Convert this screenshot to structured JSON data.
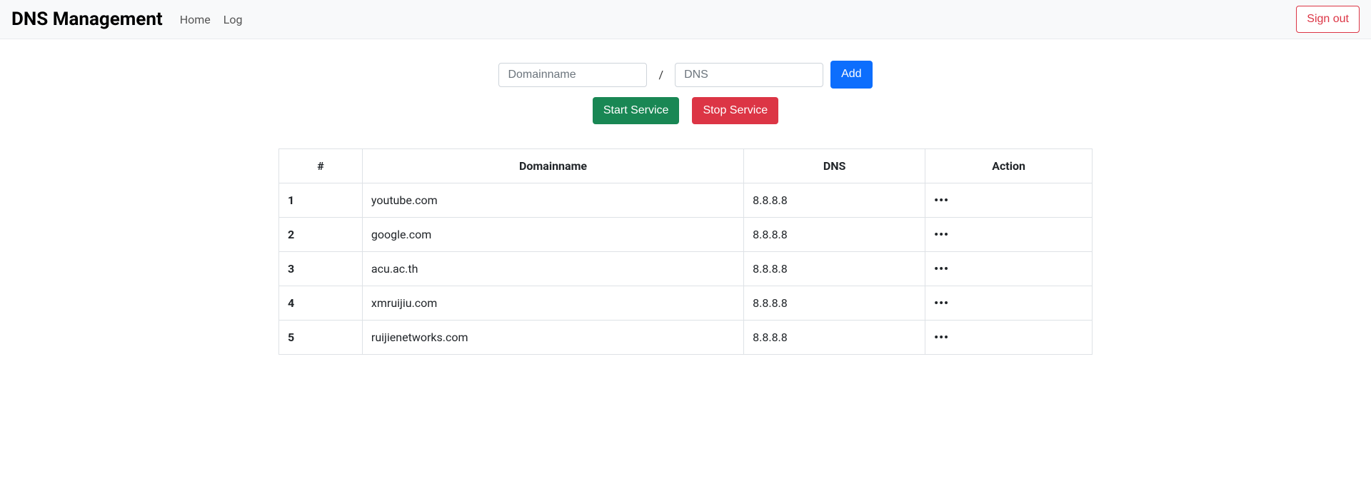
{
  "navbar": {
    "brand": "DNS Management",
    "home": "Home",
    "log": "Log",
    "signout": "Sign out"
  },
  "form": {
    "domain_placeholder": "Domainname",
    "slash": "/",
    "dns_placeholder": "DNS",
    "add": "Add",
    "start": "Start Service",
    "stop": "Stop Service"
  },
  "table": {
    "headers": {
      "index": "#",
      "domain": "Domainname",
      "dns": "DNS",
      "action": "Action"
    },
    "rows": [
      {
        "idx": "1",
        "domain": "youtube.com",
        "dns": "8.8.8.8",
        "action": "•••"
      },
      {
        "idx": "2",
        "domain": "google.com",
        "dns": "8.8.8.8",
        "action": "•••"
      },
      {
        "idx": "3",
        "domain": "acu.ac.th",
        "dns": "8.8.8.8",
        "action": "•••"
      },
      {
        "idx": "4",
        "domain": "xmruijiu.com",
        "dns": "8.8.8.8",
        "action": "•••"
      },
      {
        "idx": "5",
        "domain": "ruijienetworks.com",
        "dns": "8.8.8.8",
        "action": "•••"
      }
    ]
  }
}
